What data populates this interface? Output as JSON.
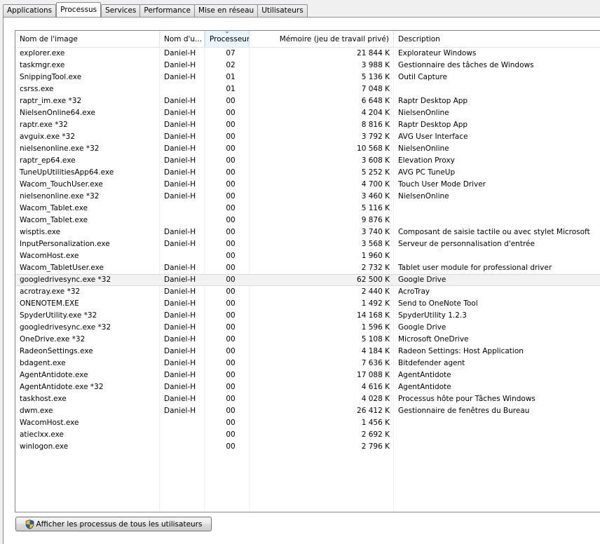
{
  "tabs": [
    {
      "label": "Applications"
    },
    {
      "label": "Processus"
    },
    {
      "label": "Services"
    },
    {
      "label": "Performance"
    },
    {
      "label": "Mise en réseau"
    },
    {
      "label": "Utilisateurs"
    }
  ],
  "active_tab": "Processus",
  "columns": {
    "name": "Nom de l'image",
    "user": "Nom d'u...",
    "cpu": "Processeur",
    "memory": "Mémoire (jeu de travail privé)",
    "description": "Description"
  },
  "sorted_column": "cpu",
  "selected_row": 19,
  "processes": [
    {
      "name": "explorer.exe",
      "user": "Daniel-H",
      "cpu": "07",
      "memory": "21 844 K",
      "description": "Explorateur Windows"
    },
    {
      "name": "taskmgr.exe",
      "user": "Daniel-H",
      "cpu": "02",
      "memory": "3 988 K",
      "description": "Gestionnaire des tâches de Windows"
    },
    {
      "name": "SnippingTool.exe",
      "user": "Daniel-H",
      "cpu": "01",
      "memory": "5 136 K",
      "description": "Outil Capture"
    },
    {
      "name": "csrss.exe",
      "user": "",
      "cpu": "01",
      "memory": "7 048 K",
      "description": ""
    },
    {
      "name": "raptr_im.exe *32",
      "user": "Daniel-H",
      "cpu": "00",
      "memory": "6 648 K",
      "description": "Raptr Desktop App"
    },
    {
      "name": "NielsenOnline64.exe",
      "user": "Daniel-H",
      "cpu": "00",
      "memory": "4 204 K",
      "description": "NielsenOnline"
    },
    {
      "name": "raptr.exe *32",
      "user": "Daniel-H",
      "cpu": "00",
      "memory": "8 816 K",
      "description": "Raptr Desktop App"
    },
    {
      "name": "avguix.exe *32",
      "user": "Daniel-H",
      "cpu": "00",
      "memory": "3 792 K",
      "description": "AVG User Interface"
    },
    {
      "name": "nielsenonline.exe *32",
      "user": "Daniel-H",
      "cpu": "00",
      "memory": "10 568 K",
      "description": "NielsenOnline"
    },
    {
      "name": "raptr_ep64.exe",
      "user": "Daniel-H",
      "cpu": "00",
      "memory": "3 608 K",
      "description": "Elevation Proxy"
    },
    {
      "name": "TuneUpUtilitiesApp64.exe",
      "user": "Daniel-H",
      "cpu": "00",
      "memory": "5 252 K",
      "description": "AVG PC TuneUp"
    },
    {
      "name": "Wacom_TouchUser.exe",
      "user": "Daniel-H",
      "cpu": "00",
      "memory": "4 700 K",
      "description": "Touch User Mode Driver"
    },
    {
      "name": "nielsenonline.exe *32",
      "user": "Daniel-H",
      "cpu": "00",
      "memory": "3 460 K",
      "description": "NielsenOnline"
    },
    {
      "name": "Wacom_Tablet.exe",
      "user": "",
      "cpu": "00",
      "memory": "5 116 K",
      "description": ""
    },
    {
      "name": "Wacom_Tablet.exe",
      "user": "",
      "cpu": "00",
      "memory": "9 876 K",
      "description": ""
    },
    {
      "name": "wisptis.exe",
      "user": "Daniel-H",
      "cpu": "00",
      "memory": "3 740 K",
      "description": "Composant de saisie tactile ou avec stylet Microsoft"
    },
    {
      "name": "InputPersonalization.exe",
      "user": "Daniel-H",
      "cpu": "00",
      "memory": "3 568 K",
      "description": "Serveur de personnalisation d'entrée"
    },
    {
      "name": "WacomHost.exe",
      "user": "",
      "cpu": "00",
      "memory": "1 960 K",
      "description": ""
    },
    {
      "name": "Wacom_TabletUser.exe",
      "user": "Daniel-H",
      "cpu": "00",
      "memory": "2 732 K",
      "description": "Tablet user module for professional driver"
    },
    {
      "name": "googledrivesync.exe *32",
      "user": "Daniel-H",
      "cpu": "00",
      "memory": "62 500 K",
      "description": "Google Drive"
    },
    {
      "name": "acrotray.exe *32",
      "user": "Daniel-H",
      "cpu": "00",
      "memory": "2 440 K",
      "description": "AcroTray"
    },
    {
      "name": "ONENOTEM.EXE",
      "user": "Daniel-H",
      "cpu": "00",
      "memory": "1 492 K",
      "description": "Send to OneNote Tool"
    },
    {
      "name": "SpyderUtility.exe *32",
      "user": "Daniel-H",
      "cpu": "00",
      "memory": "14 168 K",
      "description": "SpyderUtility 1.2.3"
    },
    {
      "name": "googledrivesync.exe *32",
      "user": "Daniel-H",
      "cpu": "00",
      "memory": "1 596 K",
      "description": "Google Drive"
    },
    {
      "name": "OneDrive.exe *32",
      "user": "Daniel-H",
      "cpu": "00",
      "memory": "5 108 K",
      "description": "Microsoft OneDrive"
    },
    {
      "name": "RadeonSettings.exe",
      "user": "Daniel-H",
      "cpu": "00",
      "memory": "4 184 K",
      "description": "Radeon Settings: Host Application"
    },
    {
      "name": "bdagent.exe",
      "user": "Daniel-H",
      "cpu": "00",
      "memory": "7 636 K",
      "description": "Bitdefender agent"
    },
    {
      "name": "AgentAntidote.exe",
      "user": "Daniel-H",
      "cpu": "00",
      "memory": "17 088 K",
      "description": "AgentAntidote"
    },
    {
      "name": "AgentAntidote.exe *32",
      "user": "Daniel-H",
      "cpu": "00",
      "memory": "4 616 K",
      "description": "AgentAntidote"
    },
    {
      "name": "taskhost.exe",
      "user": "Daniel-H",
      "cpu": "00",
      "memory": "4 028 K",
      "description": "Processus hôte pour Tâches Windows"
    },
    {
      "name": "dwm.exe",
      "user": "Daniel-H",
      "cpu": "00",
      "memory": "26 412 K",
      "description": "Gestionnaire de fenêtres du Bureau"
    },
    {
      "name": "WacomHost.exe",
      "user": "",
      "cpu": "00",
      "memory": "1 456 K",
      "description": ""
    },
    {
      "name": "atieclxx.exe",
      "user": "",
      "cpu": "00",
      "memory": "2 692 K",
      "description": ""
    },
    {
      "name": "winlogon.exe",
      "user": "",
      "cpu": "00",
      "memory": "2 796 K",
      "description": ""
    }
  ],
  "show_all_button": {
    "label": "Afficher les processus de tous les utilisateurs",
    "icon": "uac-shield-icon"
  },
  "colors": {
    "selection": "#f2f2f2",
    "sorted_header": "#eaf5fd",
    "border": "#898c95"
  }
}
